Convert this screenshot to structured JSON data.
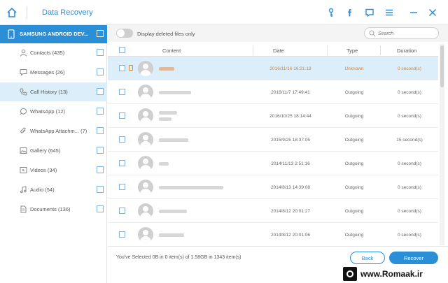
{
  "app": {
    "title": "Data Recovery",
    "accent_color": "#2a8fd6",
    "icons": [
      "home-icon",
      "key-icon",
      "facebook-icon",
      "feedback-icon",
      "menu-icon",
      "minimize-icon",
      "close-icon"
    ]
  },
  "sidebar": {
    "device_name": "SAMSUNG ANDROID DEV...",
    "items": [
      {
        "label": "Contacts (435)",
        "icon": "contact-icon"
      },
      {
        "label": "Messages (26)",
        "icon": "message-icon"
      },
      {
        "label": "Call History (13)",
        "icon": "phone-icon",
        "active": true
      },
      {
        "label": "WhatsApp (12)",
        "icon": "whatsapp-icon"
      },
      {
        "label": "WhatsApp Attachm... (7)",
        "icon": "attachment-icon"
      },
      {
        "label": "Gallery (645)",
        "icon": "gallery-icon"
      },
      {
        "label": "Videos (34)",
        "icon": "video-icon"
      },
      {
        "label": "Audio (54)",
        "icon": "audio-icon"
      },
      {
        "label": "Documents (136)",
        "icon": "document-icon"
      }
    ]
  },
  "toolbar": {
    "toggle_label": "Display deleted files only",
    "search_placeholder": "Search"
  },
  "table": {
    "headers": {
      "content": "Content",
      "date": "Date",
      "type": "Type",
      "duration": "Duration"
    },
    "rows": [
      {
        "date": "2016/11/16 16:21:19",
        "type": "Unknown",
        "duration": "0 second(s)",
        "selected": true
      },
      {
        "date": "2016/11/7 17:49:41",
        "type": "Outgoing",
        "duration": "0 second(s)"
      },
      {
        "date": "2016/10/25 18:14:44",
        "type": "Outgoing",
        "duration": "0 second(s)"
      },
      {
        "date": "2015/9/25 18:37:05",
        "type": "Outgoing",
        "duration": "15 second(s)"
      },
      {
        "date": "2014/11/13 2:51:16",
        "type": "Outgoing",
        "duration": "0 second(s)"
      },
      {
        "date": "2014/8/13 14:39:08",
        "type": "Outgoing",
        "duration": "0 second(s)"
      },
      {
        "date": "2014/8/12 20:01:27",
        "type": "Outgoing",
        "duration": "0 second(s)"
      },
      {
        "date": "2014/8/12 20:01:06",
        "type": "Outgoing",
        "duration": "0 second(s)"
      }
    ]
  },
  "footer": {
    "selection_info": "You've Selected 0B in 0 item(s) of 1.58GB in 1343 item(s)",
    "back_label": "Back",
    "recover_label": "Recover"
  },
  "watermark": {
    "text": "www.Romaak.ir"
  }
}
